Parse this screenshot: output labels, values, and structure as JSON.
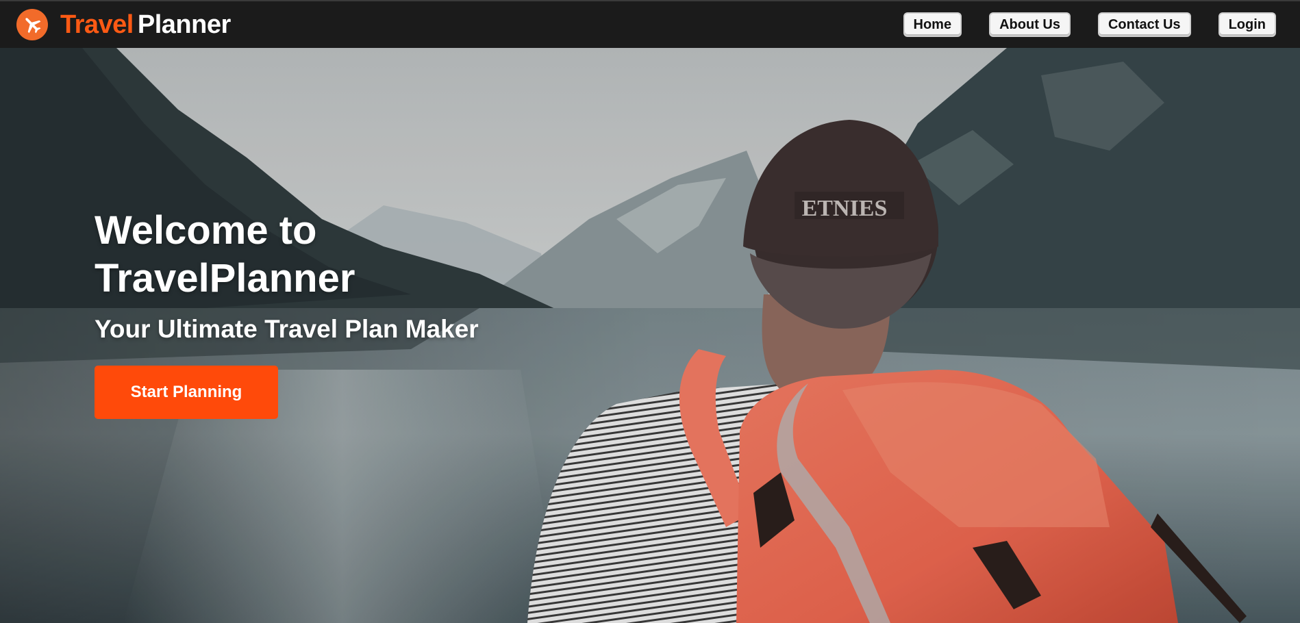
{
  "brand": {
    "word1": "Travel",
    "word2": "Planner",
    "logo_icon": "airplane-icon",
    "accent": "#ff5a14"
  },
  "nav": {
    "items": [
      {
        "label": "Home"
      },
      {
        "label": "About Us"
      },
      {
        "label": "Contact Us"
      },
      {
        "label": "Login"
      }
    ]
  },
  "hero": {
    "title_line1": "Welcome to",
    "title_line2": "TravelPlanner",
    "subtitle": "Your Ultimate Travel Plan Maker",
    "cta_label": "Start Planning",
    "cta_color": "#ff4a0a",
    "cap_text": "ETNIES"
  }
}
